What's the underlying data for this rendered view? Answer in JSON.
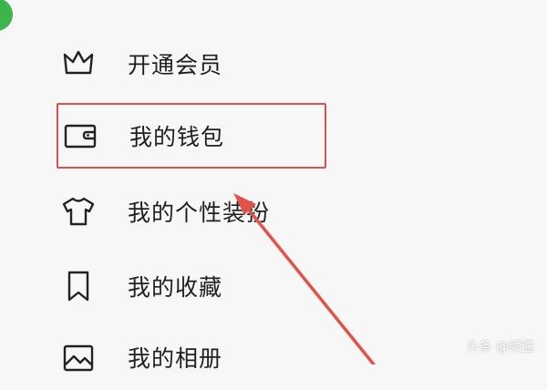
{
  "menu": {
    "items": [
      {
        "label": "开通会员",
        "icon": "crown-icon"
      },
      {
        "label": "我的钱包",
        "icon": "wallet-icon",
        "highlighted": true
      },
      {
        "label": "我的个性装扮",
        "icon": "tshirt-icon"
      },
      {
        "label": "我的收藏",
        "icon": "bookmark-icon"
      },
      {
        "label": "我的相册",
        "icon": "photo-album-icon"
      }
    ]
  },
  "annotation": {
    "highlight_color": "#d9534f",
    "arrow_color": "#e0524a"
  },
  "watermark": {
    "text": "头条 @倾鹽"
  },
  "colors": {
    "background": "#f7f7f7",
    "accent_dot": "#3cb54a"
  }
}
